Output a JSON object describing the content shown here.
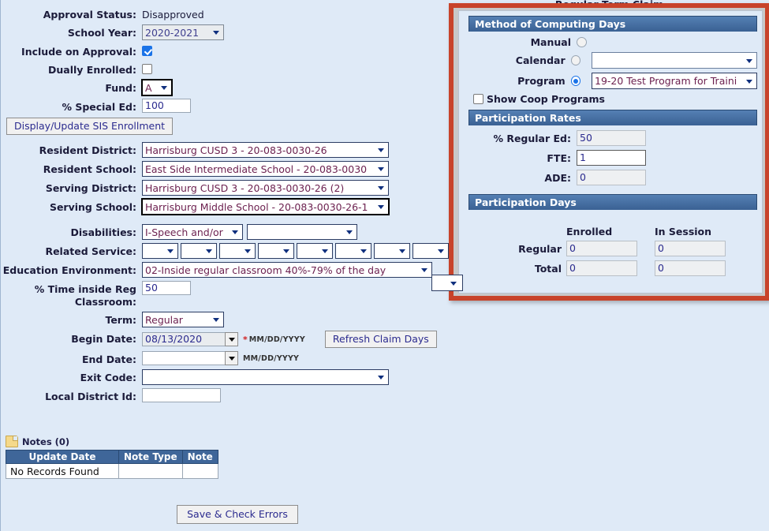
{
  "page": {
    "claim_title": "Regular Term Claim"
  },
  "left_form": {
    "approval_status": {
      "label": "Approval Status:",
      "value": "Disapproved"
    },
    "school_year": {
      "label": "School Year:",
      "value": "2020-2021"
    },
    "include_on_approval": {
      "label": "Include on Approval:",
      "checked": true
    },
    "dually_enrolled": {
      "label": "Dually Enrolled:",
      "checked": false
    },
    "fund": {
      "label": "Fund:",
      "value": "A"
    },
    "pct_special_ed": {
      "label": "% Special Ed:",
      "value": "100"
    },
    "sis_enrollment_button": "Display/Update SIS Enrollment",
    "resident_district": {
      "label": "Resident District:",
      "value": "Harrisburg CUSD 3 - 20-083-0030-26"
    },
    "resident_school": {
      "label": "Resident School:",
      "value": "East Side Intermediate School - 20-083-0030"
    },
    "serving_district": {
      "label": "Serving District:",
      "value": "Harrisburg CUSD 3 - 20-083-0030-26 (2)"
    },
    "serving_school": {
      "label": "Serving School:",
      "value": "Harrisburg Middle School - 20-083-0030-26-1"
    },
    "disabilities": {
      "label": "Disabilities:",
      "primary": "I-Speech and/or",
      "secondary": ""
    },
    "related_service": {
      "label": "Related Service:",
      "values": [
        "",
        "",
        "",
        "",
        "",
        "",
        "",
        ""
      ]
    },
    "education_environment": {
      "label": "Education Environment:",
      "value": "02-Inside regular classroom 40%-79% of the day"
    },
    "pct_time_reg_classroom": {
      "label": "% Time inside Reg\nClassroom:",
      "value": "50"
    },
    "term": {
      "label": "Term:",
      "value": "Regular"
    },
    "begin_date": {
      "label": "Begin Date:",
      "value": "08/13/2020",
      "format_hint": "MM/DD/YYYY",
      "required_mark": "*"
    },
    "end_date": {
      "label": "End Date:",
      "value": "",
      "format_hint": "MM/DD/YYYY"
    },
    "refresh_claim_days_button": "Refresh Claim Days",
    "exit_code": {
      "label": "Exit Code:",
      "value": ""
    },
    "local_district_id": {
      "label": "Local District Id:",
      "value": ""
    }
  },
  "notes": {
    "heading": "Notes (0)",
    "columns": [
      "Update Date",
      "Note Type",
      "Note"
    ],
    "empty_message": "No Records Found"
  },
  "footer": {
    "save_button": "Save & Check Errors"
  },
  "right_panel": {
    "method_section": {
      "title": "Method of Computing Days",
      "manual": {
        "label": "Manual",
        "selected": false
      },
      "calendar": {
        "label": "Calendar",
        "selected": false,
        "value": ""
      },
      "program": {
        "label": "Program",
        "selected": true,
        "value": "19-20 Test Program for Traini"
      },
      "show_coop": {
        "label": "Show Coop Programs",
        "checked": false
      }
    },
    "rates_section": {
      "title": "Participation Rates",
      "pct_regular_ed": {
        "label": "% Regular Ed:",
        "value": "50"
      },
      "fte": {
        "label": "FTE:",
        "value": "1"
      },
      "ade": {
        "label": "ADE:",
        "value": "0"
      }
    },
    "days_section": {
      "title": "Participation Days",
      "columns": [
        "Enrolled",
        "In Session"
      ],
      "rows": [
        {
          "label": "Regular",
          "enrolled": "0",
          "in_session": "0"
        },
        {
          "label": "Total",
          "enrolled": "0",
          "in_session": "0"
        }
      ]
    }
  },
  "colors": {
    "page_bg": "#dfeaf7",
    "section_header": "#3f6699",
    "highlight_border": "#c8432a",
    "link_text": "#2b2b8f",
    "select_text": "#6b1f4e"
  }
}
